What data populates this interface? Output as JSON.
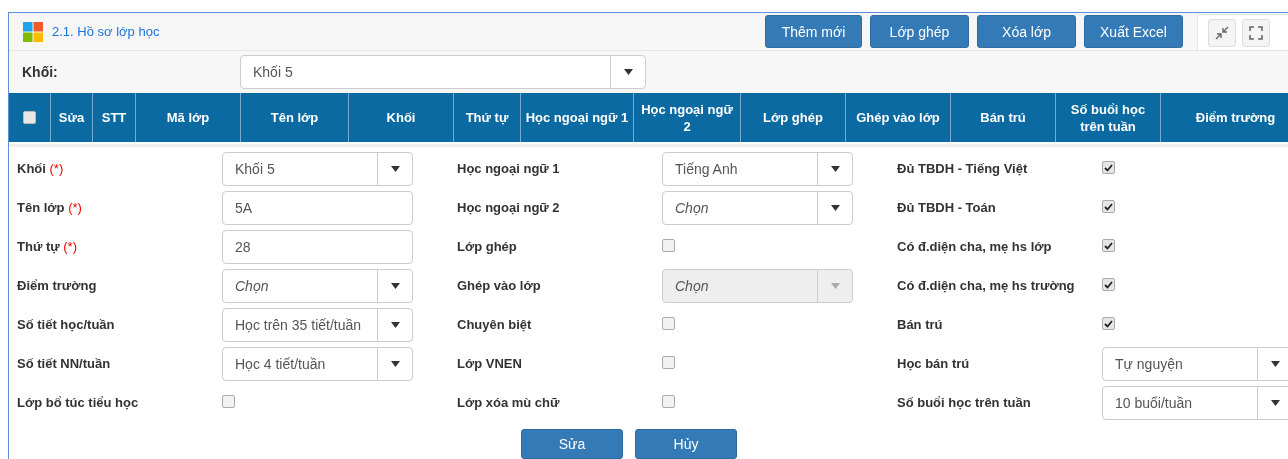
{
  "header": {
    "title": "2.1. Hồ sơ lớp học",
    "buttons": [
      "Thêm mới",
      "Lớp ghép",
      "Xóa lớp",
      "Xuất Excel"
    ]
  },
  "filter": {
    "label": "Khối:",
    "value": "Khối 5"
  },
  "table": {
    "columns": [
      {
        "kind": "checkbox",
        "checked": false
      },
      {
        "kind": "text",
        "label": "Sửa"
      },
      {
        "kind": "text",
        "label": "STT"
      },
      {
        "kind": "text",
        "label": "Mã lớp"
      },
      {
        "kind": "text",
        "label": "Tên lớp"
      },
      {
        "kind": "text",
        "label": "Khối"
      },
      {
        "kind": "text",
        "label": "Thứ tự"
      },
      {
        "kind": "text",
        "label": "Học ngoại ngữ 1"
      },
      {
        "kind": "text",
        "label": "Học ngoại ngữ 2"
      },
      {
        "kind": "text",
        "label": "Lớp ghép"
      },
      {
        "kind": "text",
        "label": "Ghép vào lớp"
      },
      {
        "kind": "text",
        "label": "Bán trú"
      },
      {
        "kind": "text",
        "label": "Số buổi học trên tuần"
      },
      {
        "kind": "text",
        "label": "Điểm trường"
      }
    ]
  },
  "form": {
    "columns": [
      [
        {
          "label": "Khối",
          "required_mark": "(*)",
          "kind": "select",
          "value": "Khối 5",
          "disabled": false
        },
        {
          "label": "Tên lớp",
          "required_mark": "(*)",
          "kind": "input",
          "value": "5A"
        },
        {
          "label": "Thứ tự",
          "required_mark": "(*)",
          "kind": "input",
          "value": "28"
        },
        {
          "label": "Điểm trường",
          "kind": "select",
          "placeholder": "Chọn",
          "disabled": false
        },
        {
          "label": "Số tiết học/tuần",
          "kind": "select",
          "value": "Học trên 35 tiết/tuần",
          "disabled": false
        },
        {
          "label": "Số tiết NN/tuần",
          "kind": "select",
          "value": "Học 4 tiết/tuần",
          "disabled": false
        },
        {
          "label": "Lớp bổ túc tiểu học",
          "kind": "checkbox",
          "checked": false
        }
      ],
      [
        {
          "label": "Học ngoại ngữ 1",
          "kind": "select",
          "value": "Tiếng Anh",
          "disabled": false
        },
        {
          "label": "Học ngoại ngữ 2",
          "kind": "select",
          "placeholder": "Chọn",
          "disabled": false
        },
        {
          "label": "Lớp ghép",
          "kind": "checkbox",
          "checked": false
        },
        {
          "label": "Ghép vào lớp",
          "kind": "select",
          "placeholder": "Chọn",
          "disabled": true
        },
        {
          "label": "Chuyên biệt",
          "kind": "checkbox",
          "checked": false
        },
        {
          "label": "Lớp VNEN",
          "kind": "checkbox",
          "checked": false
        },
        {
          "label": "Lớp xóa mù chữ",
          "kind": "checkbox",
          "checked": false
        }
      ],
      [
        {
          "label": "Đủ TBDH - Tiếng Việt",
          "kind": "checkbox",
          "checked": true
        },
        {
          "label": "Đủ TBDH - Toán",
          "kind": "checkbox",
          "checked": true
        },
        {
          "label": "Có đ.diện cha, mẹ hs lớp",
          "kind": "checkbox",
          "checked": true
        },
        {
          "label": "Có đ.diện cha, mẹ hs trường",
          "kind": "checkbox",
          "checked": true
        },
        {
          "label": "Bán trú",
          "kind": "checkbox",
          "checked": true
        },
        {
          "label": "Học bán trú",
          "kind": "select",
          "value": "Tự nguyện",
          "disabled": false
        },
        {
          "label": "Số buổi học trên tuần",
          "kind": "select",
          "value": "10 buổi/tuần",
          "disabled": false
        }
      ]
    ]
  },
  "actions": [
    "Sửa",
    "Hủy"
  ]
}
